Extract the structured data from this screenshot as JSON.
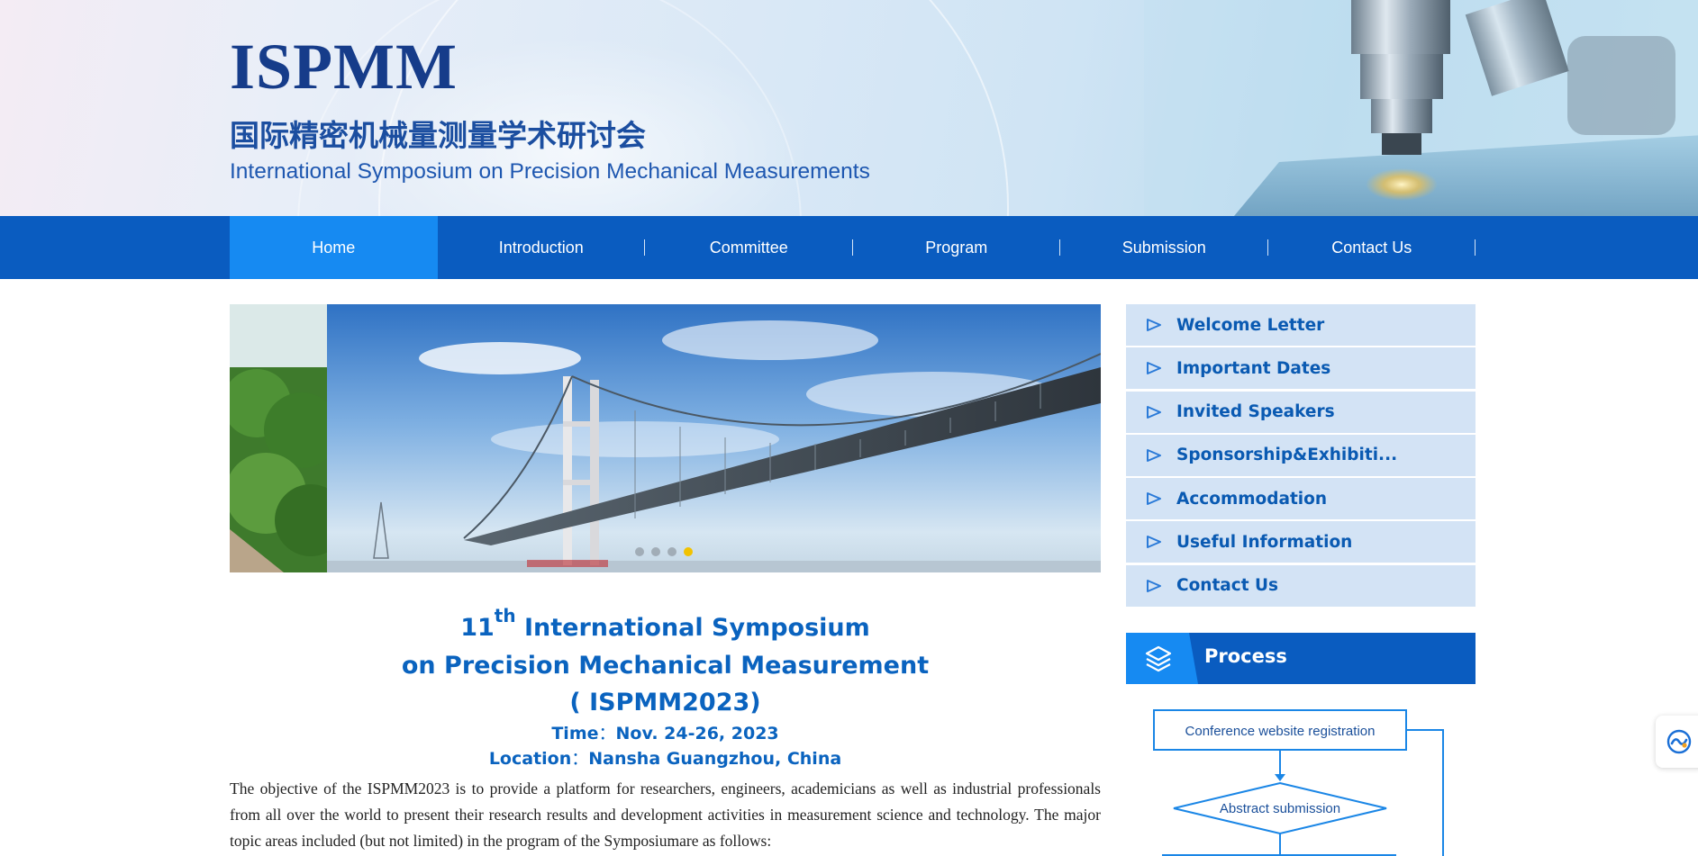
{
  "header": {
    "logo": "ISPMM",
    "title_cn": "国际精密机械量测量学术研讨会",
    "title_en": "International Symposium on Precision Mechanical Measurements"
  },
  "nav": {
    "items": [
      {
        "label": "Home",
        "active": true
      },
      {
        "label": "Introduction"
      },
      {
        "label": "Committee"
      },
      {
        "label": "Program"
      },
      {
        "label": "Submission"
      },
      {
        "label": "Contact Us"
      }
    ]
  },
  "slider": {
    "slide_count": 4,
    "active_index": 3
  },
  "main": {
    "title_num": "11",
    "title_sup": "th",
    "title_line1_rest": " International Symposium",
    "title_line2": "on Precision Mechanical Measurement",
    "title_line3": "( ISPMM2023)",
    "time_label": "Time",
    "time_value": "Nov. 24-26, 2023",
    "location_label": "Location",
    "location_value": "Nansha Guangzhou, China",
    "separator": "：",
    "description": "The objective of the ISPMM2023 is to provide a platform for researchers, engineers, academicians as well as industrial professionals from all over the world to present their research results and development activities in measurement science and technology. The major topic areas included (but not limited) in the program of the Symposiumare as follows:"
  },
  "sidebar": {
    "items": [
      {
        "label": "Welcome Letter"
      },
      {
        "label": "Important Dates"
      },
      {
        "label": "Invited Speakers"
      },
      {
        "label": "Sponsorship&Exhibiti..."
      },
      {
        "label": "Accommodation"
      },
      {
        "label": "Useful Information"
      },
      {
        "label": "Contact Us"
      }
    ],
    "process_title": "Process",
    "flow": {
      "step1": "Conference website registration",
      "step2": "Abstract submission"
    }
  },
  "colors": {
    "nav_bg": "#0a5cc0",
    "nav_active": "#168af2",
    "title_blue": "#0a63bf",
    "side_bg": "#d3e3f5",
    "dot_active": "#f2c200"
  }
}
